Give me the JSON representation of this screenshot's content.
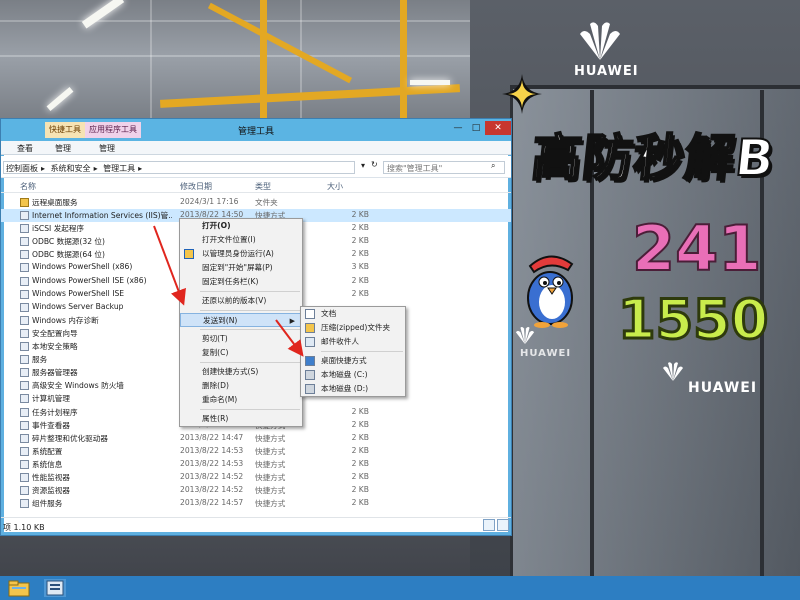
{
  "window": {
    "title": "管理工具",
    "context_tabs": [
      "快捷工具",
      "应用程序工具"
    ],
    "ribbon_tabs": [
      "查看",
      "管理",
      "管理"
    ],
    "breadcrumbs": [
      "控制面板",
      "系统和安全",
      "管理工具"
    ],
    "search_placeholder": "搜索\"管理工具\"",
    "columns": {
      "name": "名称",
      "date": "修改日期",
      "type": "类型",
      "size": "大小"
    },
    "status": "项 1.10 KB"
  },
  "files": [
    {
      "name": "远程桌面服务",
      "date": "2024/3/1 17:16",
      "type": "文件夹",
      "size": ""
    },
    {
      "name": "Internet Information Services (IIS)管...",
      "date": "2013/8/22 14:50",
      "type": "快捷方式",
      "size": "2 KB"
    },
    {
      "name": "iSCSI 发起程序",
      "date": "",
      "type": "",
      "size": "2 KB"
    },
    {
      "name": "ODBC 数据源(32 位)",
      "date": "",
      "type": "",
      "size": "2 KB"
    },
    {
      "name": "ODBC 数据源(64 位)",
      "date": "",
      "type": "",
      "size": "2 KB"
    },
    {
      "name": "Windows PowerShell (x86)",
      "date": "",
      "type": "",
      "size": "3 KB"
    },
    {
      "name": "Windows PowerShell ISE (x86)",
      "date": "",
      "type": "",
      "size": "2 KB"
    },
    {
      "name": "Windows PowerShell ISE",
      "date": "",
      "type": "",
      "size": "2 KB"
    },
    {
      "name": "Windows Server Backup",
      "date": "",
      "type": "",
      "size": ""
    },
    {
      "name": "Windows 内存诊断",
      "date": "",
      "type": "",
      "size": ""
    },
    {
      "name": "安全配置向导",
      "date": "",
      "type": "",
      "size": ""
    },
    {
      "name": "本地安全策略",
      "date": "",
      "type": "",
      "size": ""
    },
    {
      "name": "服务",
      "date": "",
      "type": "",
      "size": ""
    },
    {
      "name": "服务器管理器",
      "date": "",
      "type": "",
      "size": ""
    },
    {
      "name": "高级安全 Windows 防火墙",
      "date": "",
      "type": "",
      "size": ""
    },
    {
      "name": "计算机管理",
      "date": "",
      "type": "",
      "size": ""
    },
    {
      "name": "任务计划程序",
      "date": "2013/8/22 14:55",
      "type": "快捷方式",
      "size": "2 KB"
    },
    {
      "name": "事件查看器",
      "date": "2013/8/22 14:55",
      "type": "快捷方式",
      "size": "2 KB"
    },
    {
      "name": "碎片整理和优化驱动器",
      "date": "2013/8/22 14:47",
      "type": "快捷方式",
      "size": "2 KB"
    },
    {
      "name": "系统配置",
      "date": "2013/8/22 14:53",
      "type": "快捷方式",
      "size": "2 KB"
    },
    {
      "name": "系统信息",
      "date": "2013/8/22 14:53",
      "type": "快捷方式",
      "size": "2 KB"
    },
    {
      "name": "性能监视器",
      "date": "2013/8/22 14:52",
      "type": "快捷方式",
      "size": "2 KB"
    },
    {
      "name": "资源监视器",
      "date": "2013/8/22 14:52",
      "type": "快捷方式",
      "size": "2 KB"
    },
    {
      "name": "组件服务",
      "date": "2013/8/22 14:57",
      "type": "快捷方式",
      "size": "2 KB"
    }
  ],
  "context_menu": {
    "items": [
      "打开(O)",
      "打开文件位置(I)",
      "以管理员身份运行(A)",
      "固定到\"开始\"屏幕(P)",
      "固定到任务栏(K)",
      "还原以前的版本(V)",
      "发送到(N)",
      "剪切(T)",
      "复制(C)",
      "创建快捷方式(S)",
      "删除(D)",
      "重命名(M)",
      "属性(R)"
    ]
  },
  "send_to_menu": {
    "items": [
      "文档",
      "压缩(zipped)文件夹",
      "邮件收件人",
      "桌面快捷方式",
      "本地磁盘 (C:)",
      "本地磁盘 (D:)"
    ]
  },
  "overlay": {
    "headline": "高防秒解B",
    "number_1": "241",
    "number_2": "1550",
    "brand": "HUAWEI"
  },
  "colors": {
    "titlebar": "#5bb4e3",
    "taskbar": "#2d7ec2",
    "pink": "#e96fb7",
    "lime": "#c9ec4c",
    "annotation": "#e0261e"
  }
}
